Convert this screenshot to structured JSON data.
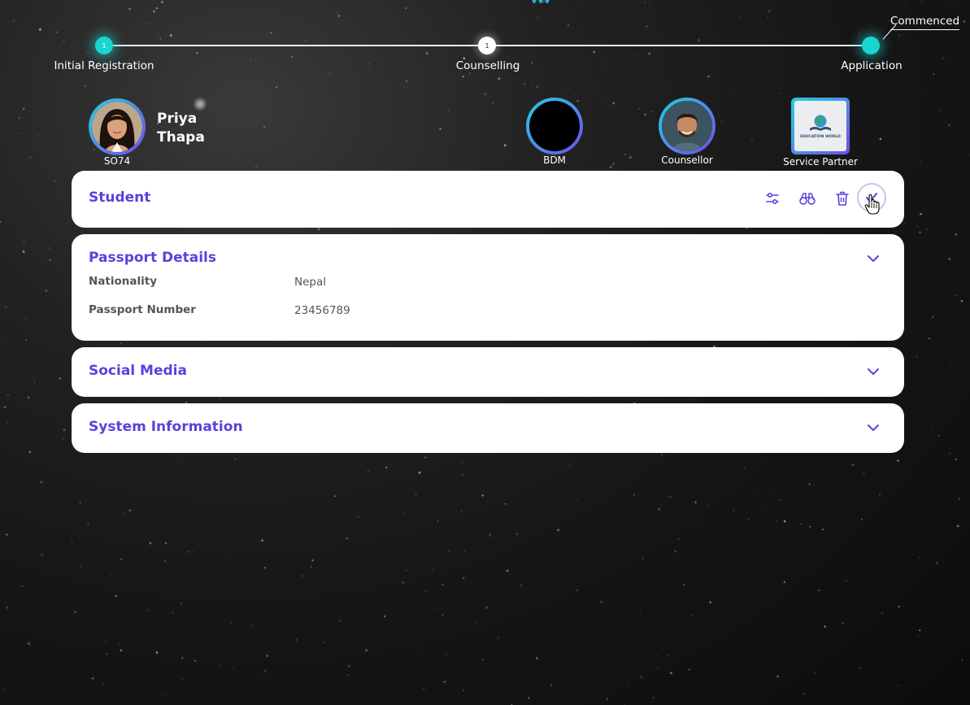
{
  "progress": {
    "steps": [
      {
        "label": "Initial Registration",
        "badge": "1"
      },
      {
        "label": "Counselling",
        "badge": "1"
      },
      {
        "label": "Application",
        "badge": ""
      }
    ],
    "status": "Commenced"
  },
  "people": {
    "student": {
      "first_name": "Priya",
      "last_name": "Thapa",
      "code": "SO74"
    },
    "bdm": {
      "label": "BDM"
    },
    "counsellor": {
      "label": "Counsellor"
    },
    "service_partner": {
      "label": "Service Partner",
      "logo_text": "EDUCATION WORLD"
    }
  },
  "cards": {
    "student": {
      "title": "Student"
    },
    "passport": {
      "title": "Passport Details",
      "fields": [
        {
          "label": "Nationality",
          "value": "Nepal"
        },
        {
          "label": "Passport Number",
          "value": "23456789"
        }
      ]
    },
    "social": {
      "title": "Social Media"
    },
    "system": {
      "title": "System Information"
    }
  },
  "icons": {
    "student_actions": [
      "sliders-icon",
      "binoculars-icon",
      "trash-icon",
      "check-icon"
    ],
    "expand": "chevron-down-icon"
  },
  "colors": {
    "accent": "#5e3fdc",
    "teal": "#19d5d0",
    "ring_start": "#21d2dc",
    "ring_end": "#6c4ee6"
  }
}
